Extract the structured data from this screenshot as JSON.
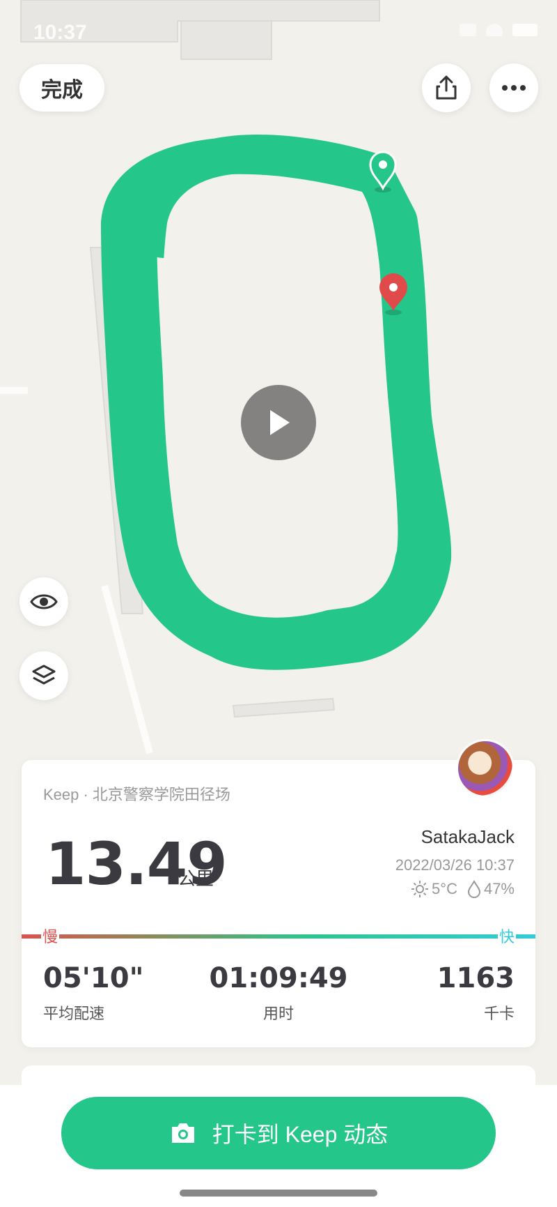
{
  "status_bar": {
    "time": "10:37"
  },
  "toolbar": {
    "done_label": "完成"
  },
  "map": {
    "route_color": "#25c68a",
    "start_marker_color": "#25c68a",
    "end_marker_color": "#e04a4a"
  },
  "summary": {
    "source": "Keep · 北京警察学院田径场",
    "distance": "13.49",
    "distance_unit": "公里",
    "username": "SatakaJack",
    "datetime": "2022/03/26 10:37",
    "temperature": "5°C",
    "humidity": "47%",
    "pace_slow_label": "慢",
    "pace_fast_label": "快",
    "stats": [
      {
        "value": "05'10\"",
        "label": "平均配速"
      },
      {
        "value": "01:09:49",
        "label": "用时"
      },
      {
        "value": "1163",
        "label": "千卡"
      }
    ]
  },
  "cta": {
    "label": "打卡到 Keep 动态"
  }
}
